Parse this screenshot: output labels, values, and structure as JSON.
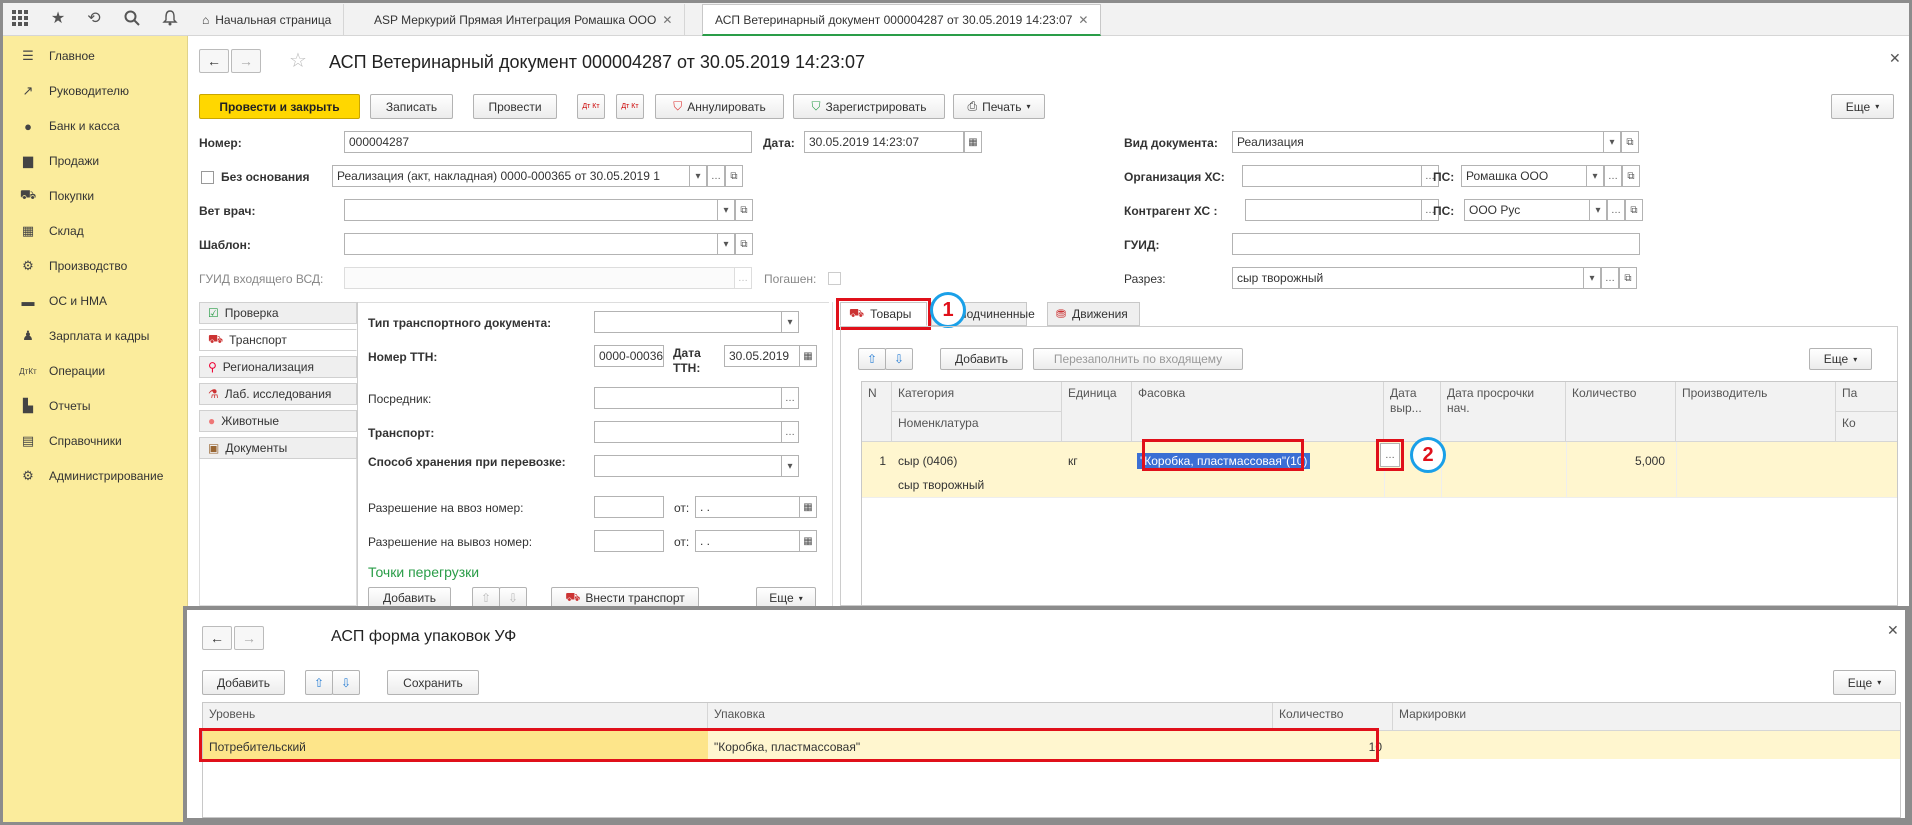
{
  "topbar": {
    "tabs": [
      {
        "label": "Начальная страница"
      },
      {
        "label": "ASP Меркурий Прямая Интеграция Ромашка ООО"
      },
      {
        "label": "АСП Ветеринарный документ 000004287 от 30.05.2019 14:23:07"
      }
    ]
  },
  "sidebar": {
    "items": [
      {
        "label": "Главное",
        "icon": "menu-icon"
      },
      {
        "label": "Руководителю",
        "icon": "chart-icon"
      },
      {
        "label": "Банк и касса",
        "icon": "coin-icon"
      },
      {
        "label": "Продажи",
        "icon": "bag-icon"
      },
      {
        "label": "Покупки",
        "icon": "cart-icon"
      },
      {
        "label": "Склад",
        "icon": "warehouse-icon"
      },
      {
        "label": "Производство",
        "icon": "factory-icon"
      },
      {
        "label": "ОС и НМА",
        "icon": "truck-icon"
      },
      {
        "label": "Зарплата и кадры",
        "icon": "person-icon"
      },
      {
        "label": "Операции",
        "icon": "dt-kt-icon"
      },
      {
        "label": "Отчеты",
        "icon": "bar-chart-icon"
      },
      {
        "label": "Справочники",
        "icon": "book-icon"
      },
      {
        "label": "Администрирование",
        "icon": "gear-icon"
      }
    ]
  },
  "form": {
    "title": "АСП Ветеринарный документ 000004287 от 30.05.2019 14:23:07",
    "toolbar": {
      "post_close": "Провести и закрыть",
      "save": "Записать",
      "post": "Провести",
      "annul": "Аннулировать",
      "register": "Зарегистрировать",
      "print": "Печать",
      "more": "Еще"
    },
    "number_label": "Номер:",
    "number_value": "000004287",
    "date_label": "Дата:",
    "date_value": "30.05.2019 14:23:07",
    "no_basis_label": "Без основания",
    "basis_value": "Реализация (акт, накладная) 0000-000365 от 30.05.2019 1",
    "vet_label": "Вет врач:",
    "template_label": "Шаблон:",
    "guid_in_label": "ГУИД входящего ВСД:",
    "repaid_label": "Погашен:",
    "doc_type_label": "Вид документа:",
    "doc_type_value": "Реализация",
    "org_label": "Организация ХС:",
    "ps_label": "ПС:",
    "org_ps_value": "Ромашка ООО",
    "contractor_label": "Контрагент ХС    :",
    "contractor_ps_value": "ООО Рус",
    "guid_label": "ГУИД:",
    "section_label": "Разрез:",
    "section_value": "сыр творожный"
  },
  "left_tabs": [
    {
      "label": "Проверка",
      "icon": "check-icon"
    },
    {
      "label": "Транспорт",
      "icon": "truck-icon"
    },
    {
      "label": "Регионализация",
      "icon": "pin-icon"
    },
    {
      "label": "Лаб. исследования",
      "icon": "flask-icon"
    },
    {
      "label": "Животные",
      "icon": "pig-icon"
    },
    {
      "label": "Документы",
      "icon": "briefcase-icon"
    }
  ],
  "transport": {
    "doc_type_label": "Тип транспортного документа:",
    "ttn_label": "Номер ТТН:",
    "ttn_value": "0000-00036",
    "ttn_date_label": "Дата ТТН:",
    "ttn_date_value": "30.05.2019",
    "intermediary_label": "Посредник:",
    "transport_label": "Транспорт:",
    "storage_label": "Способ хранения при перевозке:",
    "import_permit_label": "Разрешение на ввоз номер:",
    "export_permit_label": "Разрешение на вывоз номер:",
    "from_label": "от:",
    "date_placeholder": " .  .",
    "transfer_points": "Точки перегрузки",
    "add": "Добавить",
    "add_transport": "Внести транспорт",
    "more": "Еще"
  },
  "right_tabs": [
    {
      "label": "Товары"
    },
    {
      "label": "Подчиненные"
    },
    {
      "label": "Движения"
    }
  ],
  "goods": {
    "add": "Добавить",
    "refill": "Перезаполнить по входящему",
    "more": "Еще",
    "headers": {
      "n": "N",
      "category": "Категория",
      "nomenclature": "Номенклатура",
      "unit": "Единица",
      "packing": "Фасовка",
      "prod_date": "Дата выр...",
      "expiry": "Дата просрочки нач.",
      "qty": "Количество",
      "producer": "Производитель",
      "extra": "Па",
      "extra2": "Ко"
    },
    "rows": [
      {
        "n": "1",
        "category": "сыр (0406)",
        "nomenclature": "сыр творожный",
        "unit": "кг",
        "packing": "\"Коробка, пластмассовая\"(10)",
        "qty": "5,000"
      }
    ]
  },
  "annotations": {
    "one": "1",
    "two": "2"
  },
  "modal": {
    "title": "АСП форма упаковок УФ",
    "add": "Добавить",
    "save": "Сохранить",
    "more": "Еще",
    "headers": {
      "level": "Уровень",
      "package": "Упаковка",
      "qty": "Количество",
      "marks": "Маркировки"
    },
    "rows": [
      {
        "level": "Потребительский",
        "package": "\"Коробка, пластмассовая\"",
        "qty": "10"
      }
    ]
  }
}
